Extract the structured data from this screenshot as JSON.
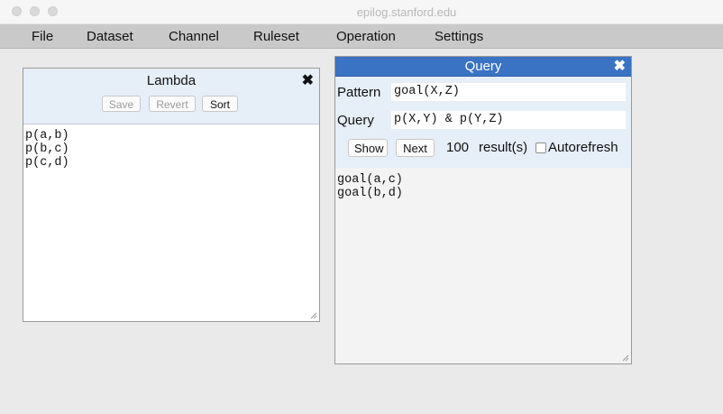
{
  "window": {
    "title": "epilog.stanford.edu"
  },
  "menu": [
    "File",
    "Dataset",
    "Channel",
    "Ruleset",
    "Operation",
    "Settings"
  ],
  "lambda": {
    "title": "Lambda",
    "close": "✖",
    "buttons": {
      "save": "Save",
      "revert": "Revert",
      "sort": "Sort"
    },
    "content": "p(a,b)\np(b,c)\np(c,d)"
  },
  "query": {
    "title": "Query",
    "close": "✖",
    "pattern_label": "Pattern",
    "pattern_value": "goal(X,Z)",
    "query_label": "Query",
    "query_value": "p(X,Y) & p(Y,Z)",
    "show_button": "Show",
    "next_button": "Next",
    "count": "100",
    "results_label": "result(s)",
    "autorefresh_label": "Autorefresh",
    "autorefresh_checked": false,
    "results": "goal(a,c)\ngoal(b,d)"
  },
  "colors": {
    "query_header": "#3a73c4",
    "panel_header": "#e6eef8",
    "menubar": "#c9c9c9"
  }
}
